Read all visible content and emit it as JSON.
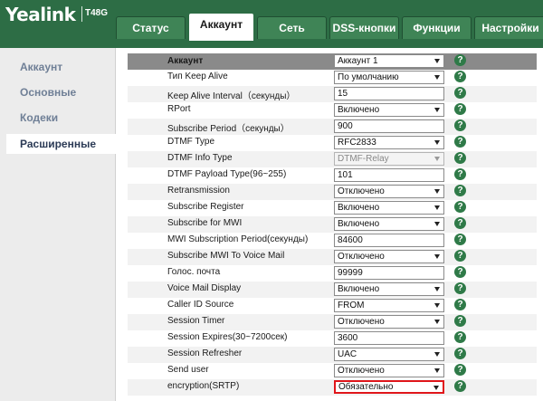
{
  "brand": {
    "logo": "Yealink",
    "model": "T48G"
  },
  "tabs": [
    {
      "label": "Статус",
      "active": false
    },
    {
      "label": "Аккаунт",
      "active": true
    },
    {
      "label": "Сеть",
      "active": false
    },
    {
      "label": "DSS-кнопки",
      "active": false
    },
    {
      "label": "Функции",
      "active": false
    },
    {
      "label": "Настройки",
      "active": false
    }
  ],
  "sidebar": {
    "items": [
      {
        "label": "Аккаунт",
        "active": false
      },
      {
        "label": "Основные",
        "active": false
      },
      {
        "label": "Кодеки",
        "active": false
      },
      {
        "label": "Расширенные",
        "active": true
      }
    ]
  },
  "section": {
    "label": "Аккаунт",
    "value": "Аккаунт 1"
  },
  "rows": [
    {
      "label": "Тип Keep Alive",
      "type": "select",
      "value": "По умолчанию"
    },
    {
      "label": "Keep Alive Interval（секунды）",
      "type": "input",
      "value": "15"
    },
    {
      "label": "RPort",
      "type": "select",
      "value": "Включено"
    },
    {
      "label": "Subscribe Period（секунды）",
      "type": "input",
      "value": "900"
    },
    {
      "label": "DTMF Type",
      "type": "select",
      "value": "RFC2833"
    },
    {
      "label": "DTMF Info Type",
      "type": "select",
      "value": "DTMF-Relay",
      "disabled": true
    },
    {
      "label": "DTMF Payload Type(96~255)",
      "type": "input",
      "value": "101"
    },
    {
      "label": "Retransmission",
      "type": "select",
      "value": "Отключено"
    },
    {
      "label": "Subscribe Register",
      "type": "select",
      "value": "Включено"
    },
    {
      "label": "Subscribe for MWI",
      "type": "select",
      "value": "Включено"
    },
    {
      "label": "MWI Subscription Period(секунды)",
      "type": "input",
      "value": "84600"
    },
    {
      "label": "Subscribe MWI To Voice Mail",
      "type": "select",
      "value": "Отключено"
    },
    {
      "label": "Голос. почта",
      "type": "input",
      "value": "99999"
    },
    {
      "label": "Voice Mail Display",
      "type": "select",
      "value": "Включено"
    },
    {
      "label": "Caller ID Source",
      "type": "select",
      "value": "FROM"
    },
    {
      "label": "Session Timer",
      "type": "select",
      "value": "Отключено"
    },
    {
      "label": "Session Expires(30~7200сек)",
      "type": "input",
      "value": "3600"
    },
    {
      "label": "Session Refresher",
      "type": "select",
      "value": "UAC"
    },
    {
      "label": "Send user",
      "type": "select",
      "value": "Отключено"
    },
    {
      "label": "encryption(SRTP)",
      "type": "select",
      "value": "Обязательно",
      "highlight": true
    }
  ],
  "help_icon": "question-icon",
  "colors": {
    "header": "#2d6d45",
    "tab": "#3f8456",
    "highlight": "#e0161b",
    "sidebar_text": "#6f7f96"
  }
}
